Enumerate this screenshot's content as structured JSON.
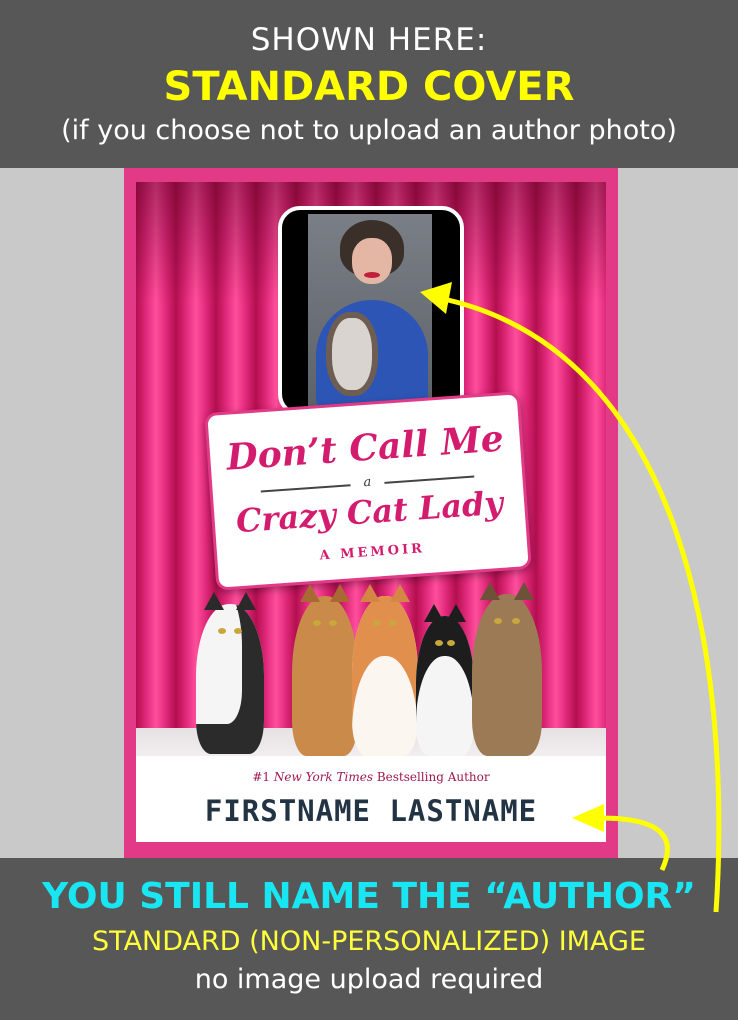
{
  "top_banner": {
    "line1": "SHOWN HERE:",
    "line2": "STANDARD COVER",
    "line3": "(if you choose not to upload an author photo)"
  },
  "cover": {
    "title_line1": "Don’t Call Me",
    "title_joiner": "a",
    "title_line2": "Crazy Cat Lady",
    "subtitle": "A MEMOIR",
    "tagline_prefix": "#1",
    "tagline_nyt": "New York Times",
    "tagline_suffix": "Bestselling Author",
    "author_name": "FIRSTNAME LASTNAME"
  },
  "bottom_banner": {
    "line1": "YOU STILL NAME THE “AUTHOR”",
    "line2": "STANDARD (NON-PERSONALIZED) IMAGE",
    "line3": "no image upload required"
  },
  "colors": {
    "banner_bg": "#575757",
    "highlight_yellow": "#ffff00",
    "highlight_cyan": "#18e6f2",
    "cover_pink": "#e23a86",
    "arrow_yellow": "#ffff00"
  }
}
